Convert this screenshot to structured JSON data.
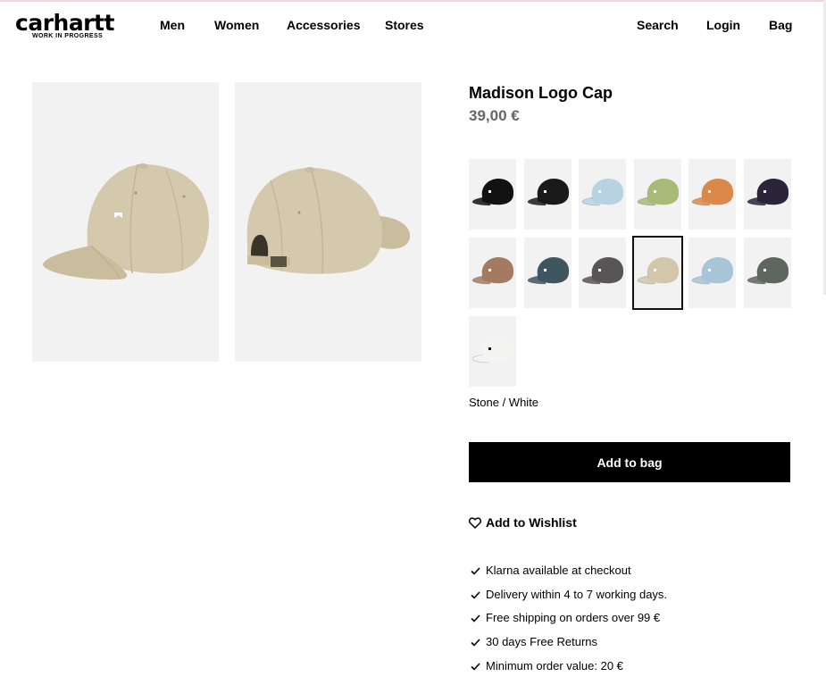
{
  "header": {
    "logo_text": "carhartt",
    "logo_sub": "WORK IN PROGRESS",
    "nav": [
      "Men",
      "Women",
      "Accessories",
      "Stores"
    ],
    "util": [
      "Search",
      "Login",
      "Bag"
    ]
  },
  "product": {
    "title": "Madison Logo Cap",
    "price": "39,00 €",
    "selected_color": "Stone / White",
    "add_to_bag": "Add to bag",
    "wishlist": "Add to Wishlist"
  },
  "swatches": [
    {
      "name": "black",
      "color": "#121212",
      "logo": "#ffffff"
    },
    {
      "name": "black-2",
      "color": "#1a1a1a",
      "logo": "#ffffff"
    },
    {
      "name": "light-blue",
      "color": "#b7d3e2",
      "logo": "#ffffff"
    },
    {
      "name": "light-green",
      "color": "#a8b978",
      "logo": "#ffffff"
    },
    {
      "name": "orange",
      "color": "#d98a4a",
      "logo": "#ffffff"
    },
    {
      "name": "dark-purple",
      "color": "#2c2438",
      "logo": "#ffffff"
    },
    {
      "name": "tan",
      "color": "#a47b62",
      "logo": "#ffffff"
    },
    {
      "name": "slate",
      "color": "#3f5560",
      "logo": "#ffffff"
    },
    {
      "name": "charcoal",
      "color": "#585556",
      "logo": "#ffffff"
    },
    {
      "name": "stone",
      "color": "#d2c7ab",
      "logo": "#ffffff"
    },
    {
      "name": "sky-blue",
      "color": "#a7c5d7",
      "logo": "#ffffff"
    },
    {
      "name": "smoke-green",
      "color": "#5e6660",
      "logo": "#ffffff"
    },
    {
      "name": "white",
      "color": "#f4f4f0",
      "logo": "#111111"
    }
  ],
  "selected_swatch_index": 9,
  "usps": [
    "Klarna available at checkout",
    "Delivery within 4 to 7 working days.",
    "Free shipping on orders over 99 €",
    "30 days Free Returns",
    "Minimum order value: 20 €"
  ]
}
